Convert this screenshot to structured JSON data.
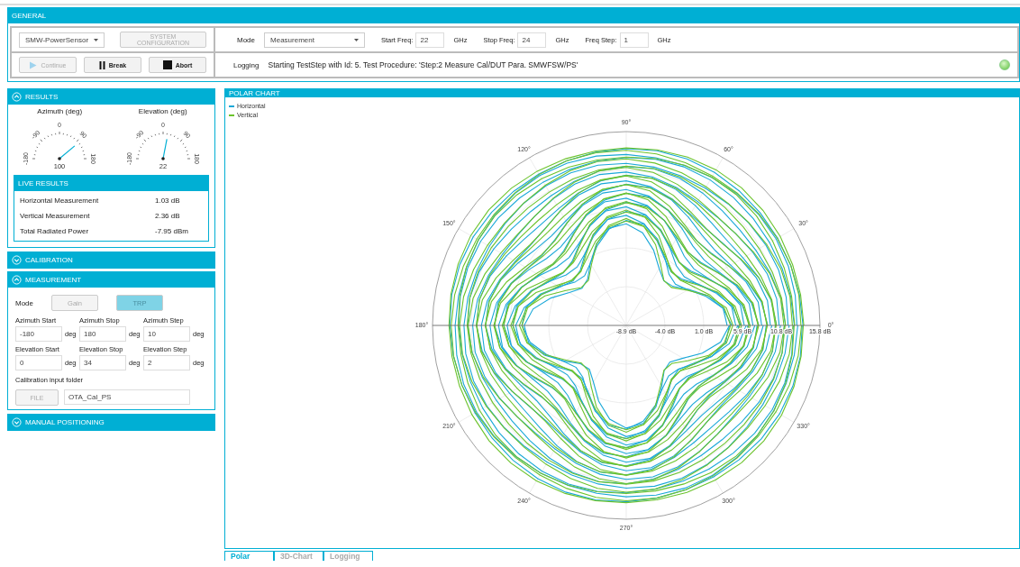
{
  "general": {
    "title": "GENERAL",
    "device_select": "SMW-PowerSensor",
    "system_configuration": {
      "label": "SYSTEM CONFIGURATION",
      "disabled": true
    },
    "mode_label": "Mode",
    "mode_select": "Measurement",
    "freq_fields": [
      {
        "label": "Start Freq:",
        "value": "22",
        "unit": "GHz"
      },
      {
        "label": "Stop Freq:",
        "value": "24",
        "unit": "GHz"
      },
      {
        "label": "Freq Step:",
        "value": "1",
        "unit": "GHz"
      }
    ],
    "buttons": [
      {
        "label": "Continue",
        "kind": "play",
        "disabled": true
      },
      {
        "label": "Break",
        "kind": "pause",
        "disabled": false
      },
      {
        "label": "Abort",
        "kind": "stop",
        "disabled": false
      }
    ],
    "logging_label": "Logging",
    "logging_text": "Starting TestStep with Id: 5. Test Procedure: 'Step:2 Measure Cal/DUT Para. SMWFSW/PS'",
    "status_on": true
  },
  "results": {
    "title": "RESULTS",
    "expanded": true,
    "gauges": [
      {
        "label": "Azimuth (deg)",
        "ticks": [
          "-180",
          "-90",
          "0",
          "90",
          "180"
        ],
        "value": "100"
      },
      {
        "label": "Elevation (deg)",
        "ticks": [
          "-180",
          "-90",
          "0",
          "90",
          "180"
        ],
        "value": "22"
      }
    ],
    "live_results": {
      "title": "LIVE RESULTS",
      "rows": [
        {
          "name": "Horizontal Measurement",
          "value": "1.03 dB"
        },
        {
          "name": "Vertical Measurement",
          "value": "2.36 dB"
        },
        {
          "name": "Total Radiated Power",
          "value": "-7.95 dBm"
        }
      ]
    }
  },
  "calibration": {
    "title": "CALIBRATION",
    "expanded": false
  },
  "measurement": {
    "title": "MEASUREMENT",
    "expanded": true,
    "mode_label": "Mode",
    "mode_buttons": [
      {
        "label": "Gain",
        "selected": false
      },
      {
        "label": "TRP",
        "selected": true
      }
    ],
    "fields": [
      {
        "label": "Azimuth Start",
        "value": "-180",
        "unit": "deg"
      },
      {
        "label": "Azimuth Stop",
        "value": "180",
        "unit": "deg"
      },
      {
        "label": "Azimuth Step",
        "value": "10",
        "unit": "deg"
      },
      {
        "label": "Elevation Start",
        "value": "0",
        "unit": "deg"
      },
      {
        "label": "Elevation Stop",
        "value": "34",
        "unit": "deg"
      },
      {
        "label": "Elevation Step",
        "value": "2",
        "unit": "deg"
      }
    ],
    "folder_label": "Calibration input folder",
    "file_button": "FILE",
    "folder_value": "OTA_Cal_PS"
  },
  "manual_positioning": {
    "title": "MANUAL POSITIONING",
    "expanded": false
  },
  "polar_chart": {
    "title": "POLAR CHART",
    "legend": [
      {
        "name": "Horizontal",
        "color": "#1aa8d8"
      },
      {
        "name": "Vertical",
        "color": "#6cc32c"
      }
    ],
    "angle_labels": [
      "0°",
      "30°",
      "60°",
      "90°",
      "120°",
      "150°",
      "180°",
      "210°",
      "240°",
      "270°",
      "300°",
      "330°"
    ],
    "radial_labels": [
      "-8.9 dB",
      "-4.0 dB",
      "1.0 dB",
      "5.9 dB",
      "10.8 dB",
      "15.8 dB"
    ]
  },
  "tabs": [
    {
      "label": "Polar",
      "selected": true
    },
    {
      "label": "3D-Chart",
      "selected": false
    },
    {
      "label": "Logging",
      "selected": false
    }
  ]
}
